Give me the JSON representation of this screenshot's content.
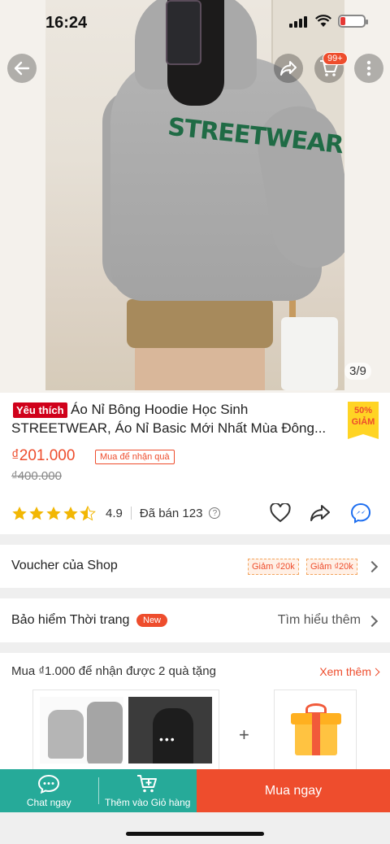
{
  "status_bar": {
    "time": "16:24"
  },
  "gallery": {
    "counter": "3/9",
    "cart_badge": "99+",
    "hoodie_print": "STREETWEAR"
  },
  "product": {
    "favorite_badge": "Yêu thích",
    "title": "Áo Nỉ Bông Hoodie Học Sinh STREETWEAR,  Áo Nỉ Basic Mới Nhất Mùa Đông...",
    "discount": {
      "pct": "50%",
      "label": "GIẢM"
    },
    "price": "₫201.000",
    "gift_tag": "Mua để nhận quà",
    "original_price": "₫400.000",
    "rating": "4.9",
    "rating_stars": 4.5,
    "sold": "Đã bán 123"
  },
  "voucher": {
    "label": "Voucher của Shop",
    "chips": [
      "Giảm ₫20k",
      "Giảm ₫20k"
    ]
  },
  "insurance": {
    "label": "Bảo hiểm Thời trang",
    "badge": "New",
    "learn_more": "Tìm hiểu thêm"
  },
  "gift": {
    "title": "Mua ₫1.000 để nhận được 2 quà tặng",
    "see_more": "Xem thêm",
    "plus": "+"
  },
  "bottom_bar": {
    "chat": "Chat ngay",
    "add_to_cart": "Thêm vào Giỏ hàng",
    "buy_now": "Mua ngay"
  },
  "colors": {
    "accent": "#ee4d2d",
    "teal": "#26aa99",
    "star": "#f2b704"
  }
}
